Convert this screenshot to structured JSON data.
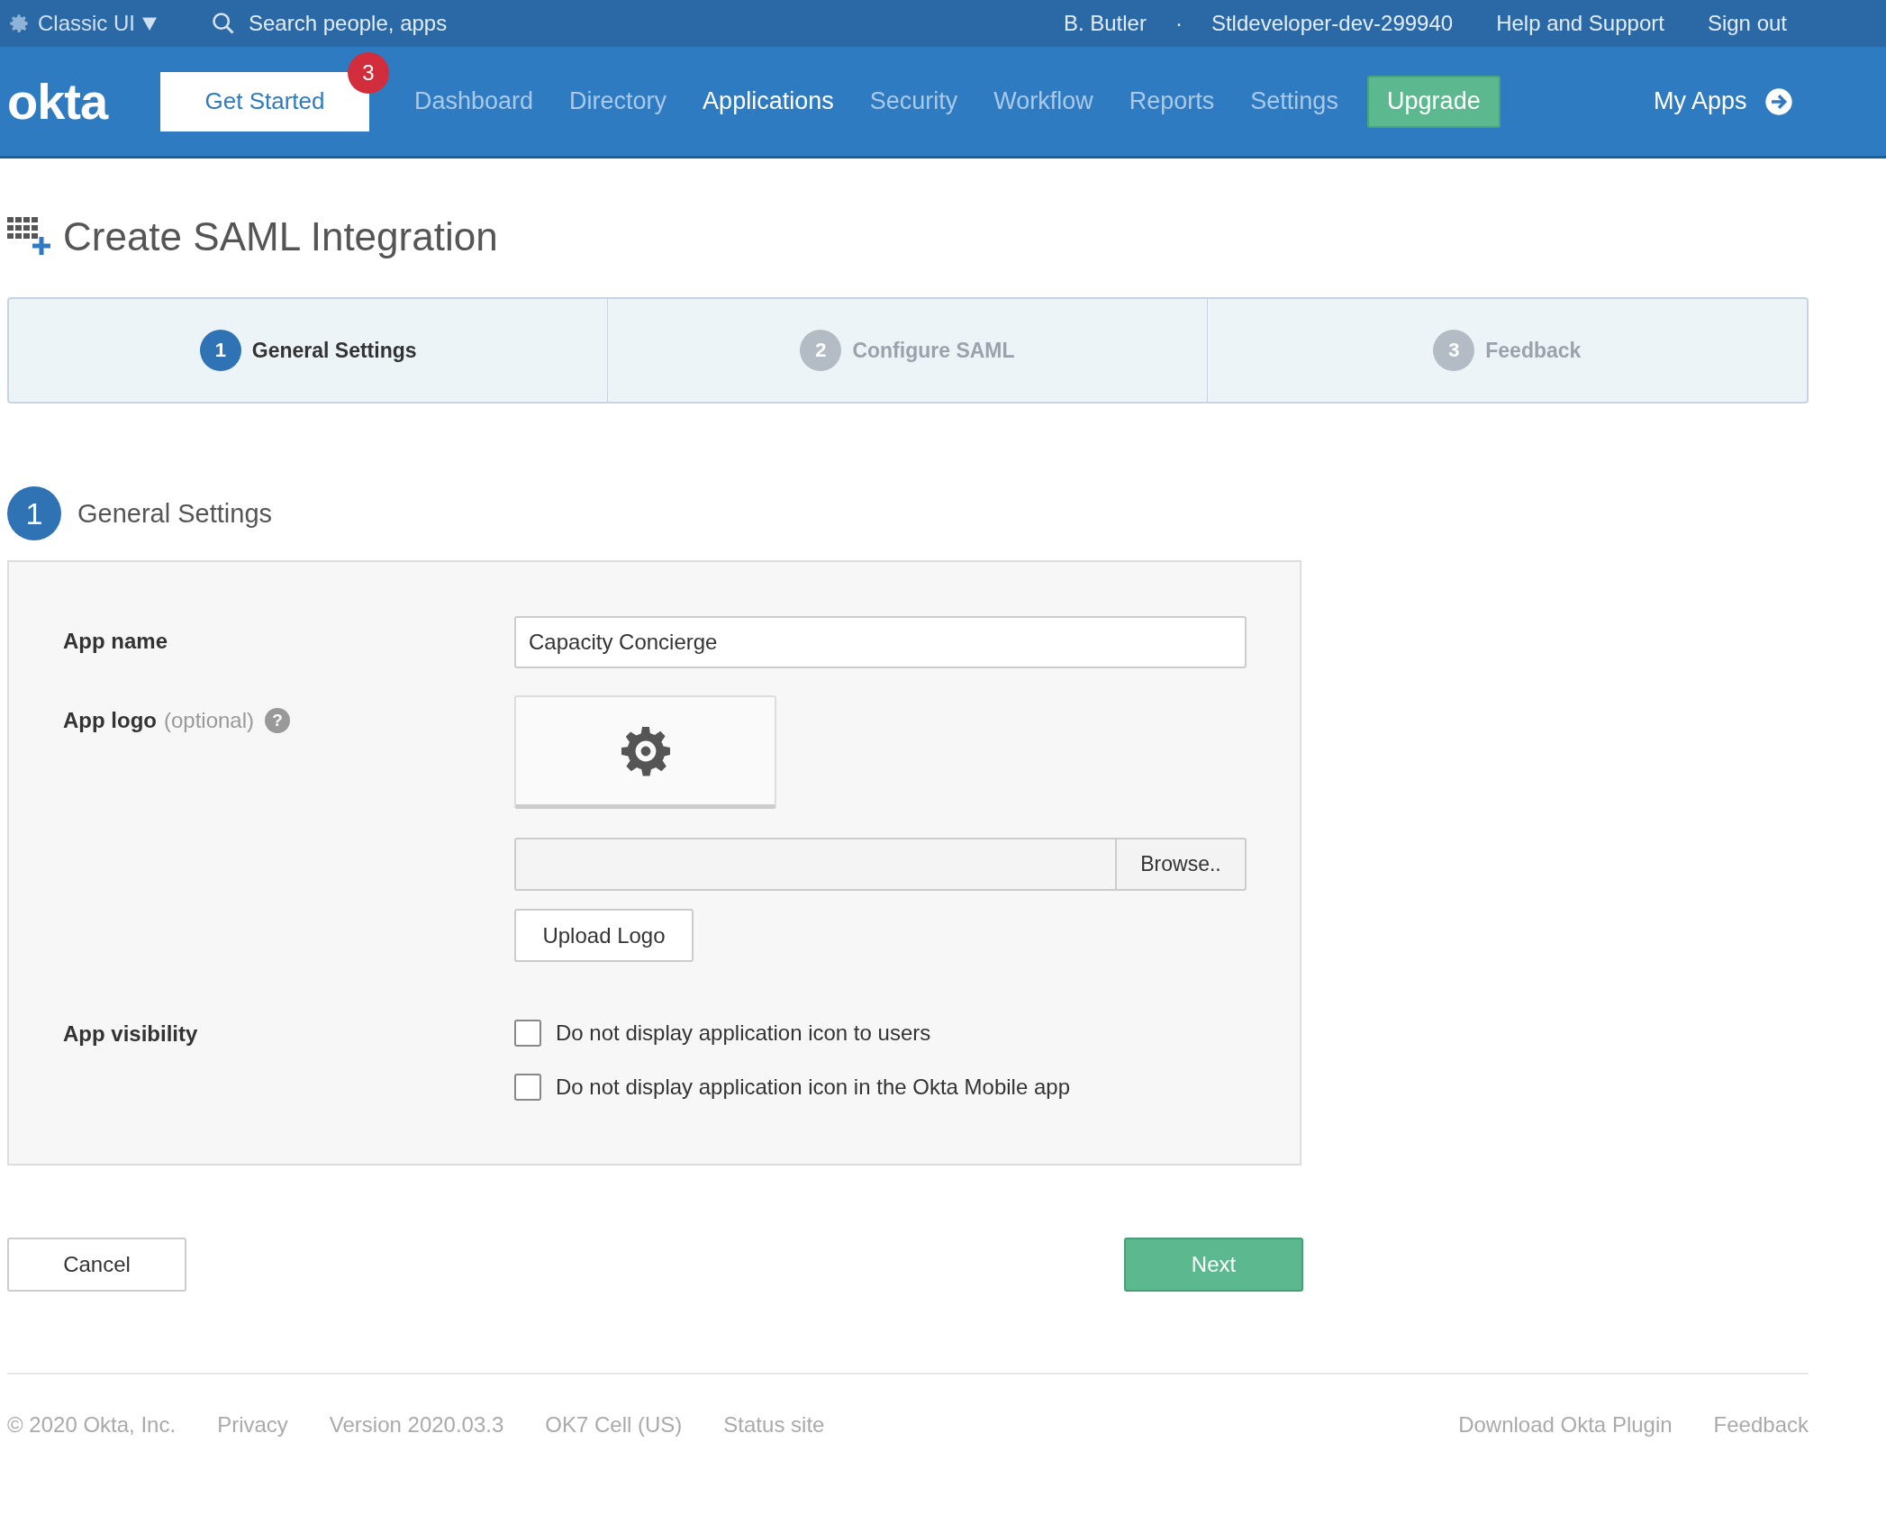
{
  "top_bar": {
    "ui_switch": "Classic UI",
    "search": {
      "placeholder": "Search people, apps"
    },
    "user": "B. Butler",
    "separator": "·",
    "org": "Stldeveloper-dev-299940",
    "links": [
      "Help and Support",
      "Sign out"
    ]
  },
  "nav": {
    "logo": "okta",
    "get_started": {
      "label": "Get Started",
      "badge": "3"
    },
    "items": [
      {
        "label": "Dashboard",
        "selected": false
      },
      {
        "label": "Directory",
        "selected": false
      },
      {
        "label": "Applications",
        "selected": true
      },
      {
        "label": "Security",
        "selected": false
      },
      {
        "label": "Workflow",
        "selected": false
      },
      {
        "label": "Reports",
        "selected": false
      },
      {
        "label": "Settings",
        "selected": false
      }
    ],
    "upgrade": "Upgrade",
    "my_apps": "My Apps"
  },
  "page_title": "Create SAML Integration",
  "steps": [
    {
      "number": "1",
      "label": "General Settings",
      "selected": true
    },
    {
      "number": "2",
      "label": "Configure SAML",
      "selected": false
    },
    {
      "number": "3",
      "label": "Feedback",
      "selected": false
    }
  ],
  "section": {
    "number": "1",
    "title": "General Settings"
  },
  "form": {
    "app_name": {
      "label": "App name",
      "value": "Capacity Concierge"
    },
    "app_logo": {
      "label": "App logo",
      "hint": "(optional)",
      "help": "?",
      "browse": "Browse..",
      "upload": "Upload Logo"
    },
    "visibility": {
      "label": "App visibility",
      "options": [
        {
          "label": "Do not display application icon to users",
          "checked": false
        },
        {
          "label": "Do not display application icon in the Okta Mobile app",
          "checked": false
        }
      ]
    }
  },
  "buttons": {
    "cancel": "Cancel",
    "next": "Next"
  },
  "footer": {
    "left": [
      "© 2020 Okta, Inc.",
      "Privacy",
      "Version 2020.03.3",
      "OK7 Cell (US)",
      "Status site"
    ],
    "right": [
      "Download Okta Plugin",
      "Feedback"
    ]
  }
}
